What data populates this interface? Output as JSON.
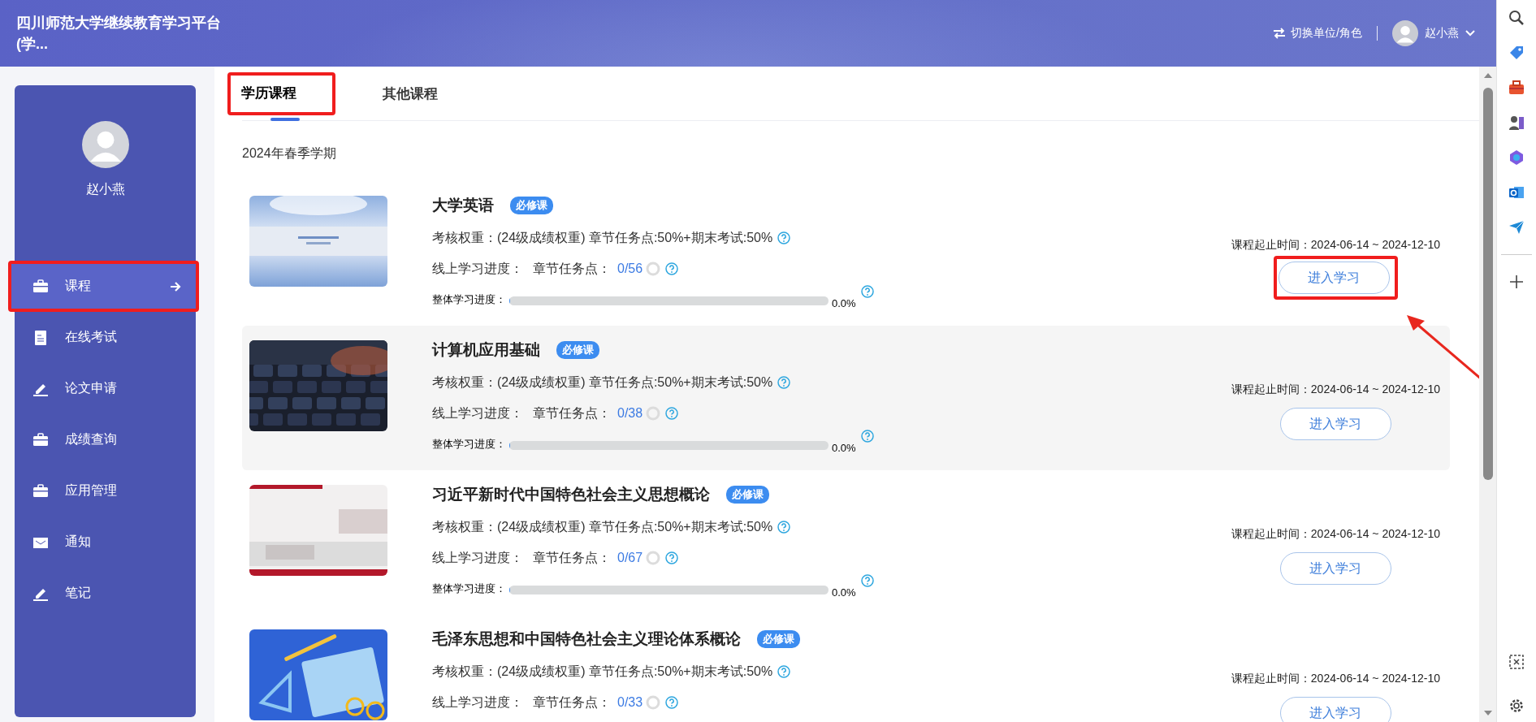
{
  "header": {
    "title": "四川师范大学继续教育学习平台(学...",
    "switch_label": "切换单位/角色",
    "user_name": "赵小燕"
  },
  "sidebar": {
    "user_name": "赵小燕",
    "items": [
      {
        "label": "课程",
        "kind": "briefcase",
        "selected": true,
        "highlighted": true
      },
      {
        "label": "在线考试",
        "kind": "document",
        "selected": false,
        "highlighted": false
      },
      {
        "label": "论文申请",
        "kind": "pen",
        "selected": false,
        "highlighted": false
      },
      {
        "label": "成绩查询",
        "kind": "briefcase",
        "selected": false,
        "highlighted": false
      },
      {
        "label": "应用管理",
        "kind": "briefcase",
        "selected": false,
        "highlighted": false
      },
      {
        "label": "通知",
        "kind": "envelope",
        "selected": false,
        "highlighted": false
      },
      {
        "label": "笔记",
        "kind": "pen",
        "selected": false,
        "highlighted": false
      }
    ]
  },
  "tabs": [
    {
      "label": "学历课程",
      "selected": true,
      "highlighted": true
    },
    {
      "label": "其他课程",
      "selected": false,
      "highlighted": false
    }
  ],
  "term": "2024年春季学期",
  "courses": [
    {
      "title": "大学英语",
      "tag": "必修课",
      "weight_label": "考核权重：",
      "weight_value": "(24级成绩权重) 章节任务点:50%+期末考试:50%",
      "progress_label": "线上学习进度：",
      "task_label": "章节任务点：",
      "task_count": "0/56",
      "overall_label": "整体学习进度：",
      "level": 0,
      "percent": "0.0%",
      "period_label": "课程起止时间：",
      "period": "2024-06-14 ~ 2024-12-10",
      "button": "进入学习",
      "hovered": false,
      "highlighted": true
    },
    {
      "title": "计算机应用基础",
      "tag": "必修课",
      "weight_label": "考核权重：",
      "weight_value": "(24级成绩权重) 章节任务点:50%+期末考试:50%",
      "progress_label": "线上学习进度：",
      "task_label": "章节任务点：",
      "task_count": "0/38",
      "overall_label": "整体学习进度：",
      "level": 0,
      "percent": "0.0%",
      "period_label": "课程起止时间：",
      "period": "2024-06-14 ~ 2024-12-10",
      "button": "进入学习",
      "hovered": true,
      "highlighted": false
    },
    {
      "title": "习近平新时代中国特色社会主义思想概论",
      "tag": "必修课",
      "weight_label": "考核权重：",
      "weight_value": "(24级成绩权重) 章节任务点:50%+期末考试:50%",
      "progress_label": "线上学习进度：",
      "task_label": "章节任务点：",
      "task_count": "0/67",
      "overall_label": "整体学习进度：",
      "level": 0,
      "percent": "0.0%",
      "period_label": "课程起止时间：",
      "period": "2024-06-14 ~ 2024-12-10",
      "button": "进入学习",
      "hovered": false,
      "highlighted": false
    },
    {
      "title": "毛泽东思想和中国特色社会主义理论体系概论",
      "tag": "必修课",
      "weight_label": "考核权重：",
      "weight_value": "(24级成绩权重) 章节任务点:50%+期末考试:50%",
      "progress_label": "线上学习进度：",
      "task_label": "章节任务点：",
      "task_count": "0/33",
      "period_label": "课程起止时间：",
      "period": "2024-06-14 ~ 2024-12-10",
      "button": "进入学习",
      "hovered": false,
      "highlighted": false
    }
  ]
}
